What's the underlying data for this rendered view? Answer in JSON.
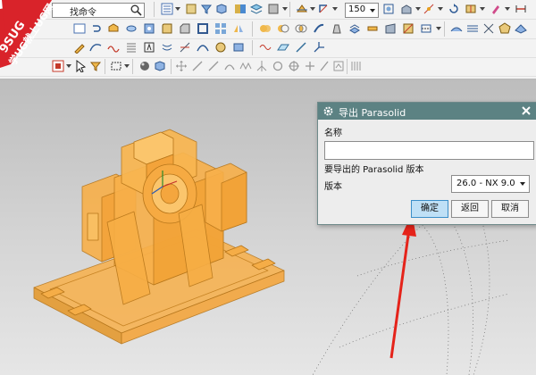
{
  "toolbar": {
    "command_search_text": "找命令",
    "zoom_value": "150",
    "icons": [
      "menu-icon",
      "find-icon",
      "layer-icon",
      "shaded-view-icon",
      "edit-section-icon",
      "snap-icon",
      "analysis-icon",
      "select-filter-icon",
      "point-icon",
      "line-icon",
      "arc-icon",
      "circle-icon",
      "plus-icon",
      "rotate-icon",
      "pan-icon"
    ]
  },
  "watermark": {
    "brand": "9SUG",
    "slogan": "学UG就上UG网"
  },
  "dialog": {
    "title": "导出 Parasolid",
    "name_label": "名称",
    "name_value": "",
    "version_heading": "要导出的 Parasolid 版本",
    "version_label": "版本",
    "version_value": "26.0 - NX 9.0",
    "ok_label": "确定",
    "back_label": "返回",
    "cancel_label": "取消"
  },
  "colors": {
    "dialog_title_bg": "#5c8283",
    "model_orange": "#f8b04a",
    "ok_button_bg": "#bfe0f6",
    "arrow_red": "#e5231a",
    "watermark_red": "#d9232a"
  }
}
